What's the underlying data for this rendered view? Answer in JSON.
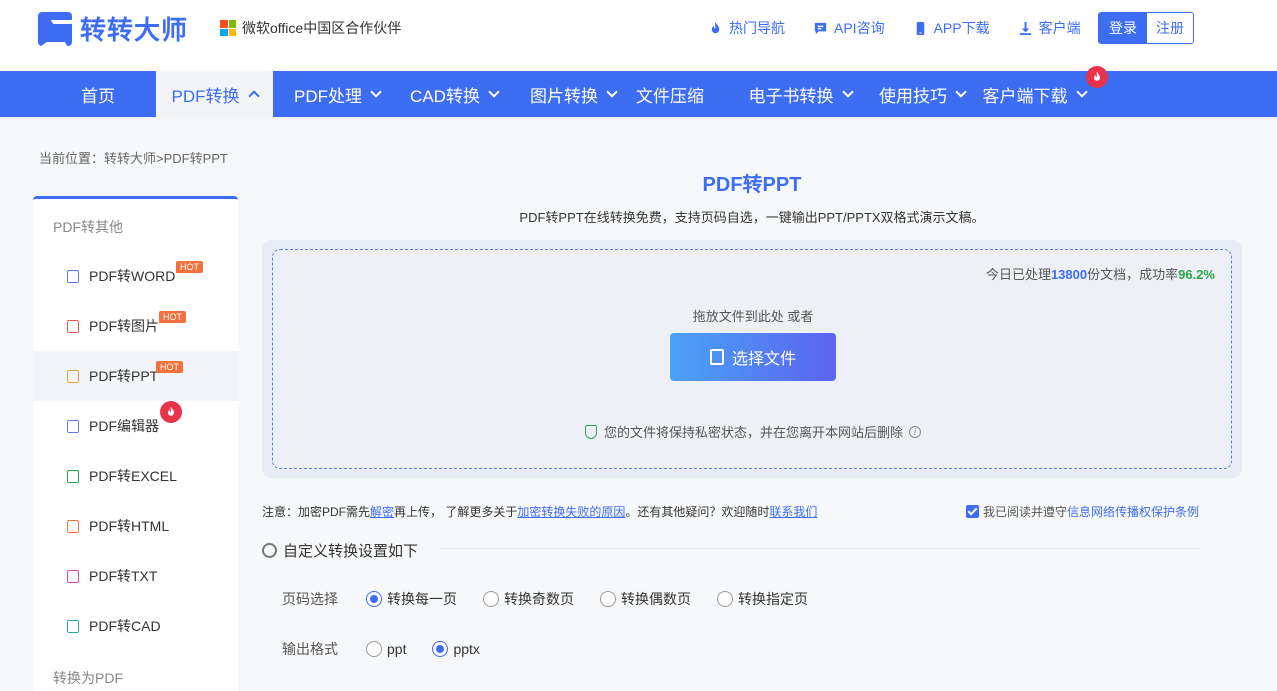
{
  "header": {
    "logo_text": "转转大师",
    "partner_text": "微软office中国区合作伙伴",
    "links": [
      {
        "label": "热门导航",
        "icon": "flame-icon"
      },
      {
        "label": "API咨询",
        "icon": "chat-icon"
      },
      {
        "label": "APP下载",
        "icon": "phone-icon"
      },
      {
        "label": "客户端",
        "icon": "download-icon"
      }
    ],
    "login_label": "登录",
    "register_label": "注册"
  },
  "nav": {
    "items": [
      {
        "label": "首页"
      },
      {
        "label": "PDF转换"
      },
      {
        "label": "PDF处理"
      },
      {
        "label": "CAD转换"
      },
      {
        "label": "图片转换"
      },
      {
        "label": "文件压缩"
      },
      {
        "label": "电子书转换"
      },
      {
        "label": "使用技巧"
      },
      {
        "label": "客户端下载"
      }
    ],
    "active": "PDF转换"
  },
  "breadcrumb": "当前位置：转转大师>PDF转PPT",
  "sidebar": {
    "group1": "PDF转其他",
    "items": [
      {
        "label": "PDF转WORD",
        "badge": "HOT"
      },
      {
        "label": "PDF转图片",
        "badge": "HOT"
      },
      {
        "label": "PDF转PPT",
        "badge": "HOT"
      },
      {
        "label": "PDF编辑器",
        "badge": ""
      },
      {
        "label": "PDF转EXCEL",
        "badge": ""
      },
      {
        "label": "PDF转HTML",
        "badge": ""
      },
      {
        "label": "PDF转TXT",
        "badge": ""
      },
      {
        "label": "PDF转CAD",
        "badge": ""
      }
    ],
    "group2": "转换为PDF"
  },
  "main": {
    "title": "PDF转PPT",
    "subtitle": "PDF转PPT在线转换免费，支持页码自选，一键输出PPT/PPTX双格式演示文稿。",
    "stats_prefix": "今日已处理",
    "stats_count": "13800",
    "stats_middle": "份文档，成功率",
    "stats_rate": "96.2%",
    "drop_text": "拖放文件到此处 或者",
    "choose_label": "选择文件",
    "privacy_text": "您的文件将保持私密状态，并在您离开本网站后删除"
  },
  "notice": {
    "p1": "注意：加密PDF需先",
    "l1": "解密",
    "p2": "再上传，  了解更多关于",
    "l2": "加密转换失败的原因",
    "p3": "。还有其他疑问？欢迎随时",
    "l3": "联系我们",
    "agree_prefix": "我已阅读并遵守",
    "agree_link": "信息网络传播权保护条例"
  },
  "settings": {
    "title": "自定义转换设置如下",
    "page_label": "页码选择",
    "page_options": [
      "转换每一页",
      "转换奇数页",
      "转换偶数页",
      "转换指定页"
    ],
    "page_selected": "转换每一页",
    "format_label": "输出格式",
    "format_options": [
      "ppt",
      "pptx"
    ],
    "format_selected": "pptx"
  },
  "colors": {
    "brand": "#3d6df2",
    "success": "#2aa74a",
    "hot": "#f2713c",
    "fire": "#e8334a"
  }
}
